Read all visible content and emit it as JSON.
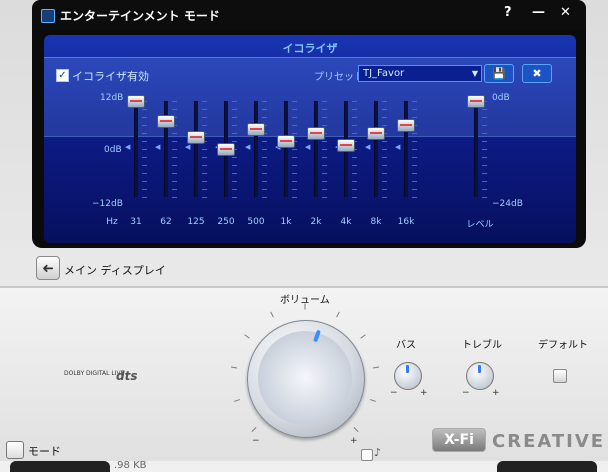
{
  "window": {
    "title": "エンターテインメント モード",
    "help": "?",
    "minimize": "—",
    "close": "✕"
  },
  "eq": {
    "title": "イコライザ",
    "enable_label": "イコライザ有効",
    "enable_check": "✓",
    "preset_label": "プリセット",
    "preset_value": "TJ_Favor",
    "preset_arrow": "▼",
    "save_icon": "💾",
    "delete_icon": "✖",
    "scale_top": "12dB",
    "scale_mid": "0dB",
    "scale_bottom": "−12dB",
    "hz_label": "Hz",
    "level_top": "0dB",
    "level_bottom": "−24dB",
    "level_label": "レベル",
    "bands": [
      {
        "label": "31",
        "gain_db": 12
      },
      {
        "label": "62",
        "gain_db": 7
      },
      {
        "label": "125",
        "gain_db": 3
      },
      {
        "label": "250",
        "gain_db": 0
      },
      {
        "label": "500",
        "gain_db": 5
      },
      {
        "label": "1k",
        "gain_db": 2
      },
      {
        "label": "2k",
        "gain_db": 4
      },
      {
        "label": "4k",
        "gain_db": 1
      },
      {
        "label": "8k",
        "gain_db": 4
      },
      {
        "label": "16k",
        "gain_db": 6
      }
    ],
    "level_db": 0
  },
  "nav": {
    "back_icon": "➜",
    "main_display": "メイン ディスプレイ"
  },
  "controls": {
    "volume": "ボリューム",
    "bass": "バス",
    "treble": "トレブル",
    "default": "デフォルト",
    "minus": "−",
    "plus": "+"
  },
  "brand": {
    "dolby": "DOLBY DIGITAL LIVE",
    "dts": "dts",
    "xfi": "X-Fi",
    "creative": "CREATIVE"
  },
  "footer": {
    "mode": "モード",
    "size": ".98 KB"
  }
}
